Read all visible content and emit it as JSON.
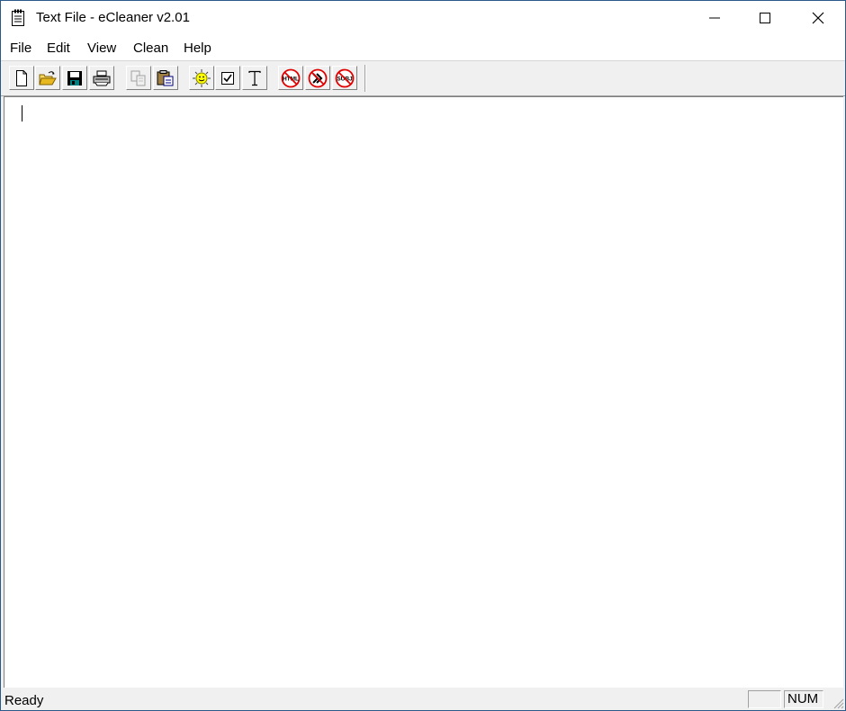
{
  "window": {
    "title": "Text File - eCleaner v2.01",
    "app_icon": "notepad-icon",
    "controls": {
      "minimize": "minimize-icon",
      "maximize": "maximize-icon",
      "close": "close-icon"
    }
  },
  "menubar": {
    "items": [
      {
        "label": "File"
      },
      {
        "label": "Edit"
      },
      {
        "label": "View"
      },
      {
        "label": "Clean"
      },
      {
        "label": "Help"
      }
    ]
  },
  "toolbar": {
    "buttons": [
      {
        "name": "new",
        "icon": "new-file-icon",
        "enabled": true
      },
      {
        "name": "open",
        "icon": "open-folder-icon",
        "enabled": true
      },
      {
        "name": "save",
        "icon": "floppy-disk-icon",
        "enabled": true
      },
      {
        "name": "print",
        "icon": "printer-icon",
        "enabled": true
      },
      {
        "name": "copy",
        "icon": "copy-icon",
        "enabled": false
      },
      {
        "name": "paste",
        "icon": "paste-icon",
        "enabled": true
      },
      {
        "name": "clean",
        "icon": "smiley-sun-icon",
        "enabled": true
      },
      {
        "name": "options",
        "icon": "checkbox-icon",
        "enabled": true
      },
      {
        "name": "font",
        "icon": "text-font-icon",
        "enabled": true
      },
      {
        "name": "remove-html",
        "icon": "no-html-icon",
        "label": "HTML",
        "enabled": true
      },
      {
        "name": "remove-quotes",
        "icon": "no-quote-marks-icon",
        "label": ">>",
        "enabled": true
      },
      {
        "name": "remove-subject",
        "icon": "no-subject-icon",
        "label": "SUBJ",
        "enabled": true
      }
    ]
  },
  "editor": {
    "content": ""
  },
  "statusbar": {
    "text": "Ready",
    "panes": [
      "",
      "NUM"
    ]
  }
}
